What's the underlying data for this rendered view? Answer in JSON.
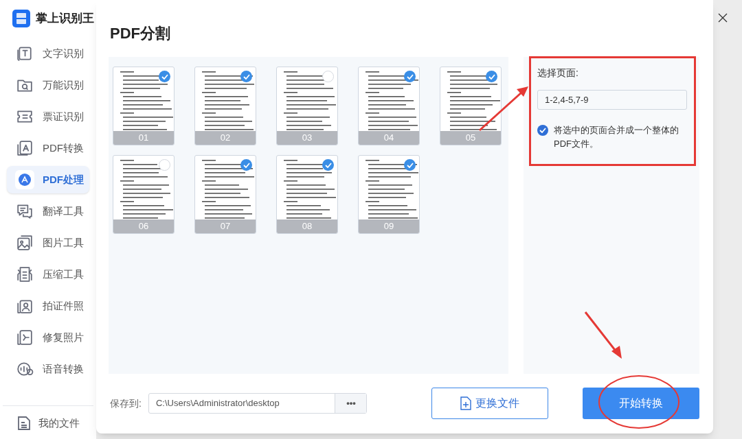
{
  "app": {
    "name": "掌上识别王"
  },
  "sidebar": {
    "items": [
      {
        "label": "文字识别",
        "selected": false
      },
      {
        "label": "万能识别",
        "selected": false
      },
      {
        "label": "票证识别",
        "selected": false
      },
      {
        "label": "PDF转换",
        "selected": false
      },
      {
        "label": "PDF处理",
        "selected": true
      },
      {
        "label": "翻译工具",
        "selected": false
      },
      {
        "label": "图片工具",
        "selected": false
      },
      {
        "label": "压缩工具",
        "selected": false
      },
      {
        "label": "拍证件照",
        "selected": false
      },
      {
        "label": "修复照片",
        "selected": false
      },
      {
        "label": "语音转换",
        "selected": false
      }
    ],
    "footer_item": "我的文件"
  },
  "dialog": {
    "title": "PDF分割",
    "pages": [
      {
        "number": "01",
        "selected": true
      },
      {
        "number": "02",
        "selected": true
      },
      {
        "number": "03",
        "selected": false
      },
      {
        "number": "04",
        "selected": true
      },
      {
        "number": "05",
        "selected": true
      },
      {
        "number": "06",
        "selected": false
      },
      {
        "number": "07",
        "selected": true
      },
      {
        "number": "08",
        "selected": true
      },
      {
        "number": "09",
        "selected": true
      }
    ],
    "page_select": {
      "label": "选择页面:",
      "value": "1-2,4-5,7-9"
    },
    "merge": {
      "checked": true,
      "label": "将选中的页面合并成一个整体的PDF文件。"
    },
    "save_to": {
      "label": "保存到:",
      "value": "C:\\Users\\Administrator\\desktop",
      "browse": "•••"
    },
    "replace_button": "更换文件",
    "start_button": "开始转换"
  }
}
